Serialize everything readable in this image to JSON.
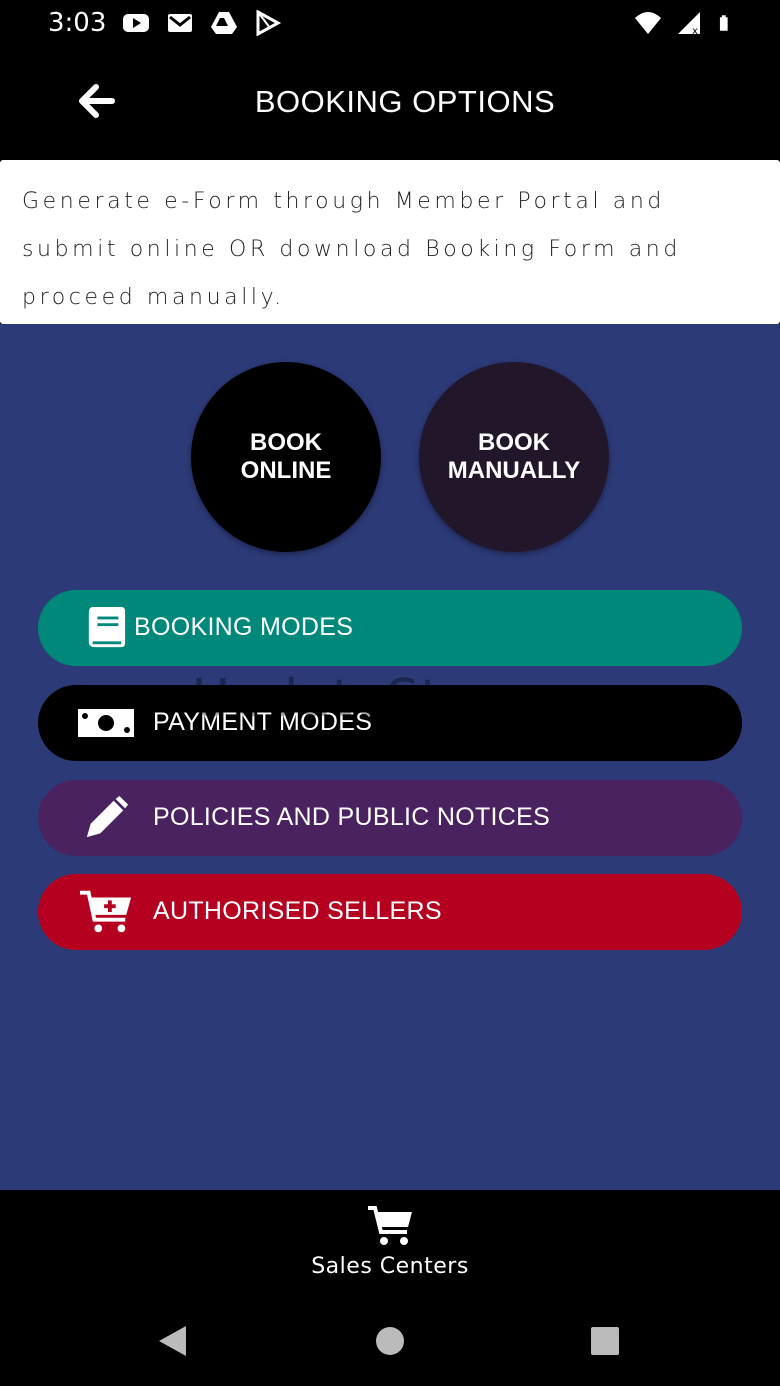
{
  "status_bar": {
    "time": "3:03",
    "icons_left": [
      "youtube-icon",
      "gmail-icon",
      "drive-icon",
      "play-store-icon"
    ],
    "icons_right": [
      "wifi-icon",
      "signal-icon",
      "battery-icon"
    ]
  },
  "app_bar": {
    "title": "BOOKING OPTIONS",
    "back_icon": "back-arrow-icon"
  },
  "description": "Generate e-Form through Member Portal and submit online OR download Booking Form and proceed manually.",
  "circle_buttons": [
    {
      "label": "BOOK\nONLINE",
      "color": "#000000"
    },
    {
      "label": "BOOK\nMANUALLY",
      "color": "#22162a"
    }
  ],
  "menu": [
    {
      "label": "BOOKING MODES",
      "icon": "book-icon",
      "color": "#00887a"
    },
    {
      "label": "PAYMENT MODES",
      "icon": "money-icon",
      "color": "#000000"
    },
    {
      "label": "POLICIES AND PUBLIC NOTICES",
      "icon": "pencil-icon",
      "color": "#4a2260"
    },
    {
      "label": "AUTHORISED SELLERS",
      "icon": "cart-plus-icon",
      "color": "#b50020"
    }
  ],
  "watermark": "UpdateStar.com",
  "bottom_nav": {
    "label": "Sales Centers",
    "icon": "shopping-cart-icon"
  },
  "system_nav": [
    "back-triangle-icon",
    "home-circle-icon",
    "recents-square-icon"
  ],
  "colors": {
    "background": "#2c3a78",
    "app_bar": "#000000"
  }
}
